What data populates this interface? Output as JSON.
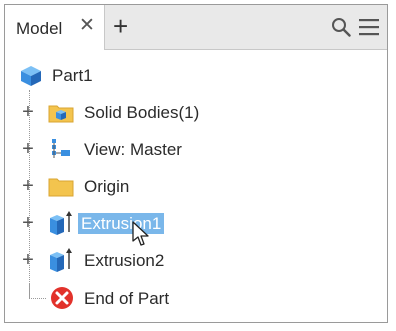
{
  "browser": {
    "tab_label": "Model",
    "tab_close_glyph": "✕",
    "add_tab_glyph": "+",
    "search_icon": "search-icon",
    "menu_icon": "hamburger-menu-icon"
  },
  "tree": {
    "expand_glyph": "+",
    "root": {
      "label": "Part1",
      "icon": "part-icon"
    },
    "nodes": [
      {
        "label": "Solid Bodies(1)",
        "icon": "solid-bodies-folder-icon",
        "expandable": true,
        "selected": false
      },
      {
        "label": "View: Master",
        "icon": "view-rep-icon",
        "expandable": true,
        "selected": false
      },
      {
        "label": "Origin",
        "icon": "folder-icon",
        "expandable": true,
        "selected": false
      },
      {
        "label": "Extrusion1",
        "icon": "extrusion-icon",
        "expandable": true,
        "selected": true
      },
      {
        "label": "Extrusion2",
        "icon": "extrusion-icon",
        "expandable": true,
        "selected": false
      },
      {
        "label": "End of Part",
        "icon": "end-of-part-icon",
        "expandable": false,
        "selected": false
      }
    ]
  },
  "colors": {
    "selection": "#7ab7ea",
    "folder": "#f3c44e",
    "part_blue": "#3a8fe0",
    "end_red": "#e2322b"
  }
}
